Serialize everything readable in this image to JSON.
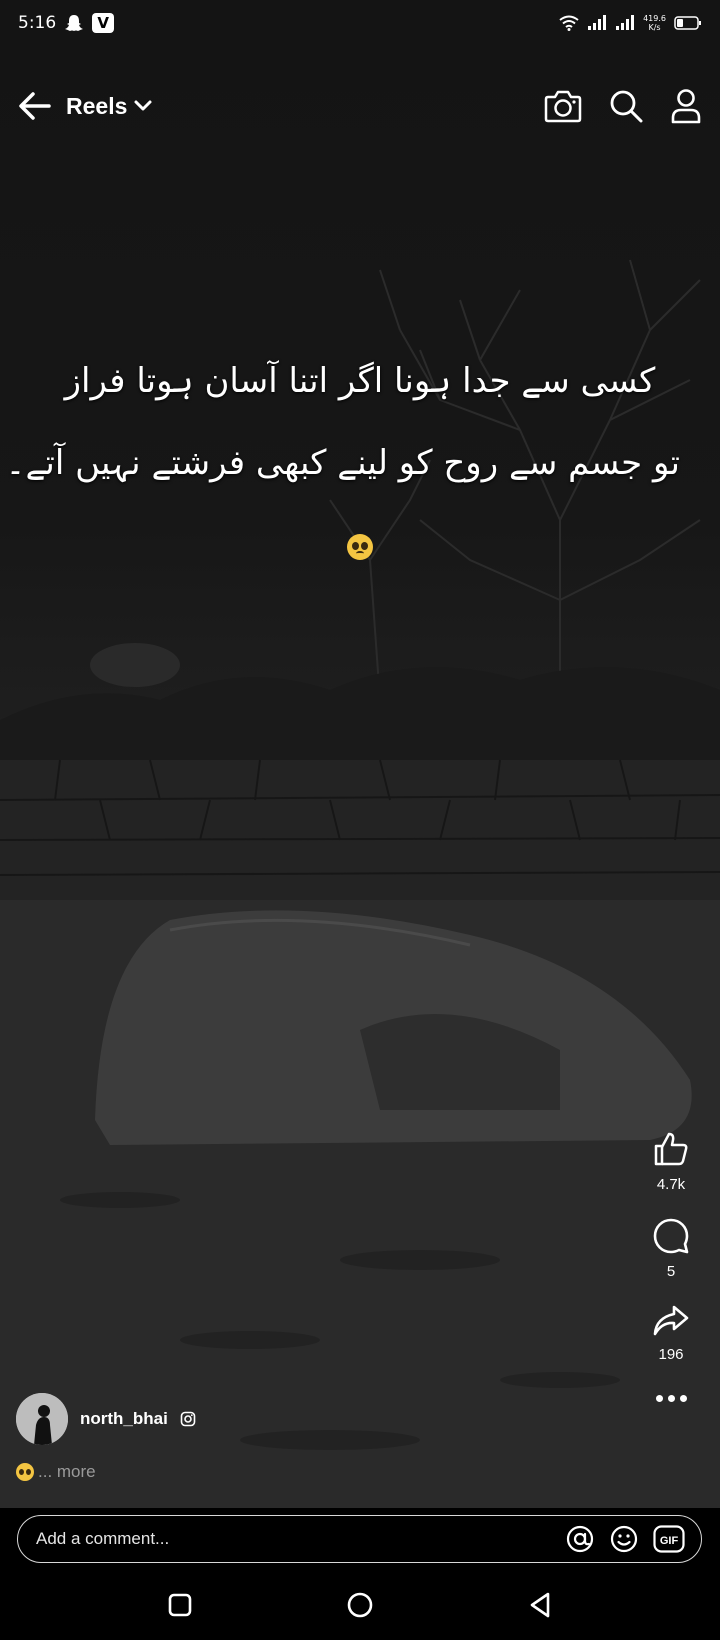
{
  "status_bar": {
    "time": "5:16",
    "net_speed_value": "419.6",
    "net_speed_unit": "K/s",
    "icons": [
      "snapchat-icon",
      "v-app-icon",
      "wifi-icon",
      "signal-icon",
      "signal-icon",
      "battery-icon"
    ]
  },
  "header": {
    "title": "Reels",
    "back_icon": "arrow-left-icon",
    "dropdown_icon": "chevron-down-icon",
    "actions": [
      "camera-icon",
      "search-icon",
      "profile-icon"
    ]
  },
  "reel": {
    "quote_line_1": "کسی سے جدا ہونا اگر اتنا آسان ہوتا فراز",
    "quote_line_2": "تو جسم سے روح کو لینے کبھی فرشتے نہیں آتے۔",
    "quote_emoji": "pleading-face-emoji"
  },
  "actions": {
    "like_count": "4.7k",
    "comment_count": "5",
    "share_count": "196"
  },
  "author": {
    "username": "north_bhai",
    "badge_icon": "instagram-icon"
  },
  "caption": {
    "more_text": "... more"
  },
  "comment": {
    "placeholder": "Add a comment...",
    "icons": [
      "mention-icon",
      "emoji-icon",
      "gif-icon"
    ]
  },
  "system_nav": [
    "recents-square-icon",
    "home-circle-icon",
    "back-triangle-icon"
  ],
  "colors": {
    "background": "#000000",
    "text": "#ffffff",
    "muted": "#9a9a9a"
  }
}
